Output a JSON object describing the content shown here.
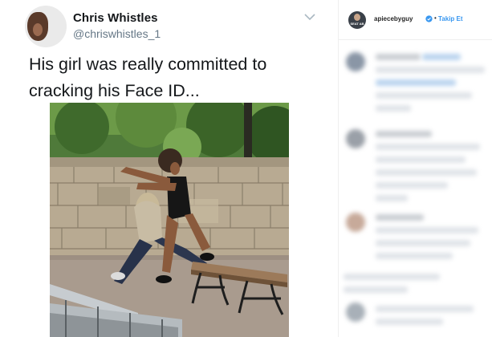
{
  "tweet": {
    "display_name": "Chris Whistles",
    "handle": "@chriswhistles_1",
    "text_line1": "His girl was really committed to",
    "text_line2": "cracking his Face ID..."
  },
  "instagram": {
    "username": "apiecebyguy",
    "separator": "•",
    "follow_label": "Takip Et",
    "avatar_text": "SEAT AB",
    "accent_color": "#3897f0",
    "verified_color": "#3897f0"
  },
  "icons": {
    "tweet_menu": "chevron-down-icon",
    "verified": "verified-badge-icon"
  }
}
